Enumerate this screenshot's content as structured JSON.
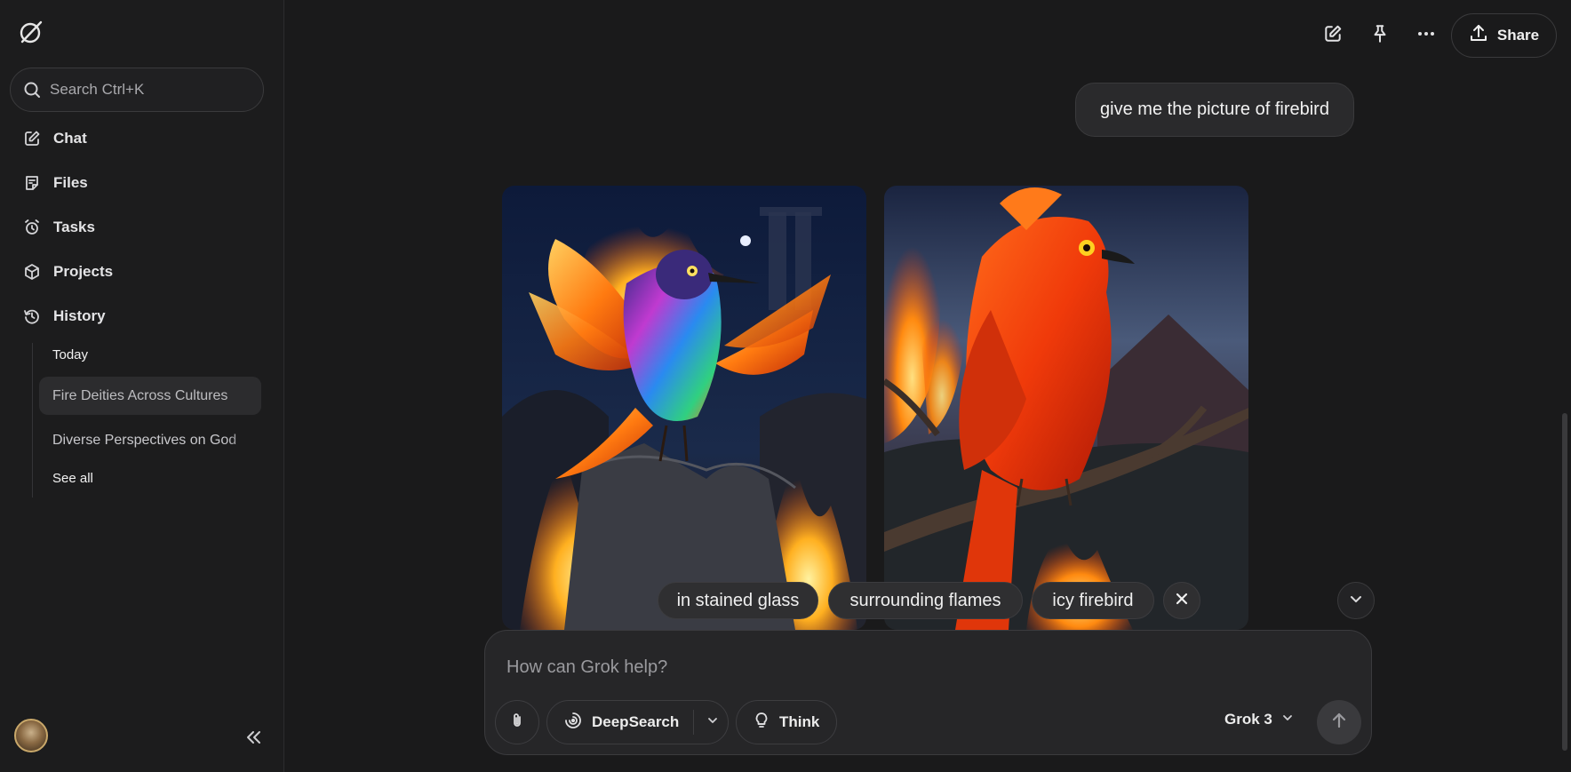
{
  "sidebar": {
    "search_label": "Search Ctrl+K",
    "nav": [
      {
        "label": "Chat",
        "icon": "edit-icon"
      },
      {
        "label": "Files",
        "icon": "file-icon"
      },
      {
        "label": "Tasks",
        "icon": "alarm-icon"
      },
      {
        "label": "Projects",
        "icon": "cube-icon"
      },
      {
        "label": "History",
        "icon": "history-icon"
      }
    ],
    "history": {
      "group": "Today",
      "items": [
        "Fire Deities Across Cultures",
        "Diverse Perspectives on God"
      ],
      "see_all": "See all"
    }
  },
  "header": {
    "share_label": "Share"
  },
  "conversation": {
    "user_message": "give me the picture of firebird",
    "suggestions": [
      "in stained glass",
      "surrounding flames",
      "icy firebird"
    ]
  },
  "composer": {
    "placeholder": "How can Grok help?",
    "deepsearch_label": "DeepSearch",
    "think_label": "Think",
    "model_label": "Grok 3"
  },
  "colors": {
    "background": "#1a1a1b",
    "sidebar": "#1c1c1d",
    "bubble": "#2a2a2c",
    "composer": "#262628"
  }
}
